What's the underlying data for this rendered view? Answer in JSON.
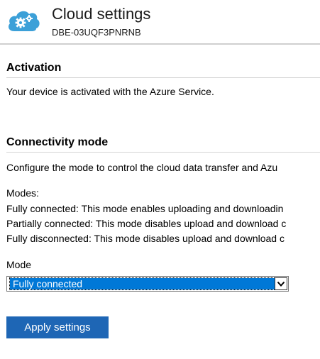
{
  "header": {
    "title": "Cloud settings",
    "device_id": "DBE-03UQF3PNRNB",
    "logo_icon": "cloud-gears-icon",
    "accent_color": "#3ca0d8"
  },
  "activation": {
    "heading": "Activation",
    "status_text": "Your device is activated with the Azure Service."
  },
  "connectivity": {
    "heading": "Connectivity mode",
    "description": "Configure the mode to control the cloud data transfer and Azu",
    "modes_label": "Modes:",
    "modes": [
      "Fully connected: This mode enables uploading and downloadin",
      "Partially connected: This mode disables upload and download c",
      "Fully disconnected: This mode disables upload and download c"
    ],
    "mode_field_label": "Mode",
    "mode_selected": "Fully connected",
    "mode_select_icon": "chevron-down-icon",
    "selection_color": "#0078d7"
  },
  "actions": {
    "apply_label": "Apply settings",
    "button_color": "#1e66b5"
  }
}
